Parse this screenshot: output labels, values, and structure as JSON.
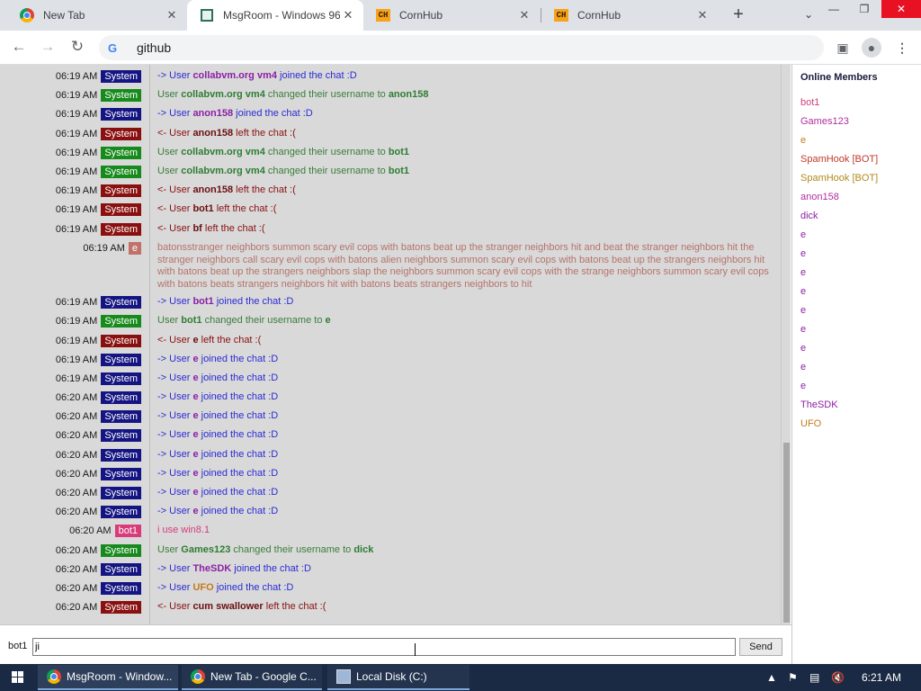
{
  "browser": {
    "tabs": [
      {
        "title": "New Tab",
        "icon": "chrome-icon"
      },
      {
        "title": "MsgRoom - Windows 96",
        "icon": "msgroom-icon"
      },
      {
        "title": "CornHub",
        "icon": "cornhub-icon"
      },
      {
        "title": "CornHub",
        "icon": "cornhub-icon"
      }
    ],
    "address": "github"
  },
  "chat": {
    "messages": [
      {
        "time": "06:19 AM",
        "badge": "System",
        "kind": "join",
        "parts": [
          "-> User ",
          "collabvm.org vm4",
          " joined the chat :D"
        ]
      },
      {
        "time": "06:19 AM",
        "badge": "System",
        "kind": "rename",
        "parts": [
          "User ",
          "collabvm.org vm4",
          " changed their username to ",
          "anon158"
        ]
      },
      {
        "time": "06:19 AM",
        "badge": "System",
        "kind": "join",
        "parts": [
          "-> User ",
          "anon158",
          " joined the chat :D"
        ]
      },
      {
        "time": "06:19 AM",
        "badge": "System",
        "kind": "leave",
        "parts": [
          "<- User ",
          "anon158",
          " left the chat :("
        ]
      },
      {
        "time": "06:19 AM",
        "badge": "System",
        "kind": "rename",
        "parts": [
          "User ",
          "collabvm.org vm4",
          " changed their username to ",
          "bot1"
        ]
      },
      {
        "time": "06:19 AM",
        "badge": "System",
        "kind": "rename",
        "parts": [
          "User ",
          "collabvm.org vm4",
          " changed their username to ",
          "bot1"
        ]
      },
      {
        "time": "06:19 AM",
        "badge": "System",
        "kind": "leave",
        "parts": [
          "<- User ",
          "anon158",
          " left the chat :("
        ]
      },
      {
        "time": "06:19 AM",
        "badge": "System",
        "kind": "leave",
        "parts": [
          "<- User ",
          "bot1",
          " left the chat :("
        ]
      },
      {
        "time": "06:19 AM",
        "badge": "System",
        "kind": "leave",
        "parts": [
          "<- User ",
          "bf",
          " left the chat :("
        ]
      },
      {
        "time": "06:19 AM",
        "badge": "e",
        "kind": "e",
        "parts": [
          "batonsstranger neighbors summon scary evil cops with batons beat up the stranger neighbors hit and beat the stranger neighbors hit the stranger neighbors call scary evil cops with batons alien neighbors summon scary evil cops with batons beat up the strangers neighbors hit with batons beat up the strangers neighbors slap the neighbors summon scary evil cops with the strange neighbors summon scary evil cops with batons beats strangers neighbors hit with batons beats strangers neighbors to hit"
        ]
      },
      {
        "time": "06:19 AM",
        "badge": "System",
        "kind": "join",
        "parts": [
          "-> User ",
          "bot1",
          " joined the chat :D"
        ]
      },
      {
        "time": "06:19 AM",
        "badge": "System",
        "kind": "rename",
        "parts": [
          "User ",
          "bot1",
          " changed their username to ",
          "e"
        ]
      },
      {
        "time": "06:19 AM",
        "badge": "System",
        "kind": "leave",
        "parts": [
          "<- User ",
          "e",
          " left the chat :("
        ]
      },
      {
        "time": "06:19 AM",
        "badge": "System",
        "kind": "join",
        "parts": [
          "-> User ",
          "e",
          " joined the chat :D"
        ]
      },
      {
        "time": "06:19 AM",
        "badge": "System",
        "kind": "join",
        "parts": [
          "-> User ",
          "e",
          " joined the chat :D"
        ]
      },
      {
        "time": "06:20 AM",
        "badge": "System",
        "kind": "join",
        "parts": [
          "-> User ",
          "e",
          " joined the chat :D"
        ]
      },
      {
        "time": "06:20 AM",
        "badge": "System",
        "kind": "join",
        "parts": [
          "-> User ",
          "e",
          " joined the chat :D"
        ]
      },
      {
        "time": "06:20 AM",
        "badge": "System",
        "kind": "join",
        "parts": [
          "-> User ",
          "e",
          " joined the chat :D"
        ]
      },
      {
        "time": "06:20 AM",
        "badge": "System",
        "kind": "join",
        "parts": [
          "-> User ",
          "e",
          " joined the chat :D"
        ]
      },
      {
        "time": "06:20 AM",
        "badge": "System",
        "kind": "join",
        "parts": [
          "-> User ",
          "e",
          " joined the chat :D"
        ]
      },
      {
        "time": "06:20 AM",
        "badge": "System",
        "kind": "join",
        "parts": [
          "-> User ",
          "e",
          " joined the chat :D"
        ]
      },
      {
        "time": "06:20 AM",
        "badge": "System",
        "kind": "join",
        "parts": [
          "-> User ",
          "e",
          " joined the chat :D"
        ]
      },
      {
        "time": "06:20 AM",
        "badge": "bot1",
        "kind": "bot1",
        "parts": [
          "i use win8.1"
        ]
      },
      {
        "time": "06:20 AM",
        "badge": "System",
        "kind": "rename",
        "parts": [
          "User ",
          "Games123",
          " changed their username to ",
          "dick"
        ]
      },
      {
        "time": "06:20 AM",
        "badge": "System",
        "kind": "join",
        "parts": [
          "-> User ",
          "TheSDK",
          " joined the chat :D"
        ]
      },
      {
        "time": "06:20 AM",
        "badge": "System",
        "kind": "join",
        "parts": [
          "-> User ",
          "UFO",
          " joined the chat :D"
        ]
      },
      {
        "time": "06:20 AM",
        "badge": "System",
        "kind": "leave",
        "parts": [
          "<- User ",
          "cum swallower",
          " left the chat :("
        ]
      }
    ],
    "members_title": "Online Members",
    "members": [
      {
        "name": "bot1",
        "color": "#d83b7a"
      },
      {
        "name": "Games123",
        "color": "#b0309e"
      },
      {
        "name": "e",
        "color": "#c47a1a"
      },
      {
        "name": "SpamHook [BOT]",
        "color": "#c0392b"
      },
      {
        "name": "SpamHook [BOT]",
        "color": "#b08a1a"
      },
      {
        "name": "anon158",
        "color": "#b0309e"
      },
      {
        "name": "dick",
        "color": "#8c1fa7"
      },
      {
        "name": "e",
        "color": "#8c1fa7"
      },
      {
        "name": "e",
        "color": "#8c1fa7"
      },
      {
        "name": "e",
        "color": "#8c1fa7"
      },
      {
        "name": "e",
        "color": "#8c1fa7"
      },
      {
        "name": "e",
        "color": "#8c1fa7"
      },
      {
        "name": "e",
        "color": "#8c1fa7"
      },
      {
        "name": "e",
        "color": "#8c1fa7"
      },
      {
        "name": "e",
        "color": "#8c1fa7"
      },
      {
        "name": "e",
        "color": "#8c1fa7"
      },
      {
        "name": "TheSDK",
        "color": "#8c1fa7"
      },
      {
        "name": "UFO",
        "color": "#c47a1a"
      }
    ],
    "input": {
      "username": "bot1",
      "value": "ji",
      "send_label": "Send"
    }
  },
  "taskbar": {
    "items": [
      {
        "label": "MsgRoom - Window...",
        "icon": "chrome-icon"
      },
      {
        "label": "New Tab - Google C...",
        "icon": "chrome-icon"
      },
      {
        "label": "Local Disk (C:)",
        "icon": "disk-icon"
      }
    ],
    "time": "6:21 AM"
  }
}
